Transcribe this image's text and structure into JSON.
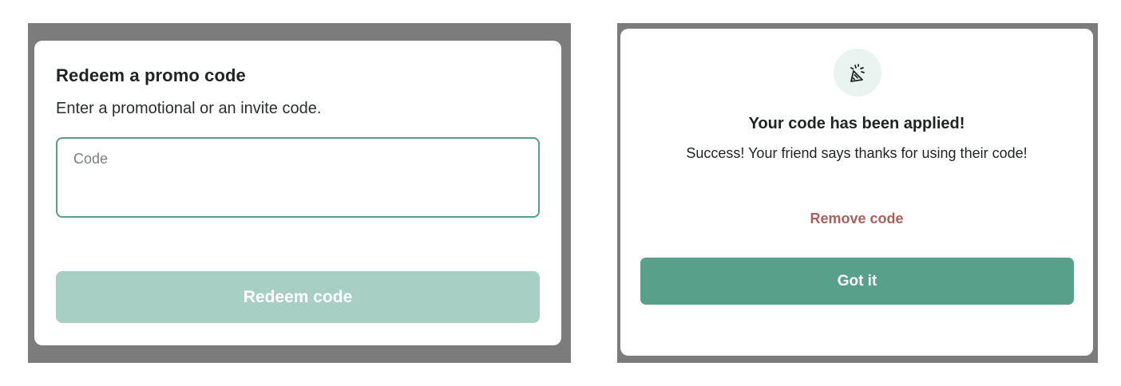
{
  "redeem_modal": {
    "title": "Redeem a promo code",
    "subtitle": "Enter a promotional or an invite code.",
    "code_input": {
      "value": "",
      "placeholder": "Code"
    },
    "redeem_button_label": "Redeem code",
    "redeem_button_state": "disabled"
  },
  "success_modal": {
    "icon": "party-popper-icon",
    "title": "Your code has been applied!",
    "message": "Success! Your friend says thanks for using their code!",
    "remove_link_label": "Remove code",
    "got_it_button_label": "Got it"
  },
  "colors": {
    "overlay": "#7c7c7c",
    "accent": "#58a08a",
    "accent_disabled": "#a8cfc3",
    "input_border": "#5a9c88",
    "icon_bg": "#e9f3ef",
    "remove_link": "#a8625c"
  }
}
